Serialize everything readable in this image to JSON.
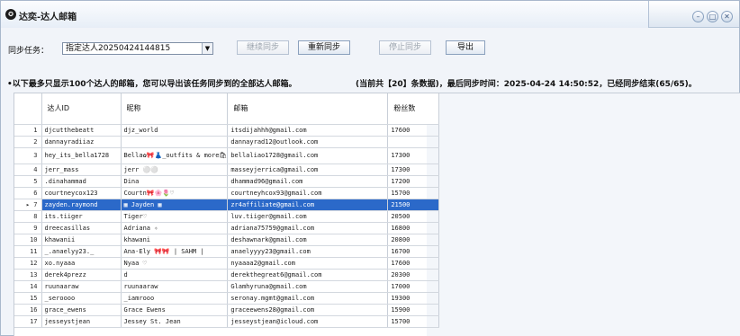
{
  "window": {
    "icon_glyph": "✪",
    "title": "达奕-达人邮箱",
    "controls": [
      "–",
      "□",
      "✕"
    ]
  },
  "toolbar": {
    "sync_task_label": "同步任务：",
    "sync_task_value": "指定达人20250424144815",
    "continue_sync": "继续同步",
    "resync": "重新同步",
    "stop_sync": "停止同步",
    "export": "导出"
  },
  "notice": "•以下最多只显示100个达人的邮箱，您可以导出该任务同步到的全部达人邮箱。",
  "status": "(当前共【20】条数据)，最后同步时间：2025-04-24 14:50:52，已经同步结束(65/65)。",
  "table": {
    "columns": [
      "达人ID",
      "昵称",
      "邮箱",
      "粉丝数"
    ],
    "selected_index": 6,
    "rows": [
      {
        "n": "1",
        "id": "djcutthebeatt",
        "nick": "djz_world",
        "email": "itsdijahhh@gmail.com",
        "fans": "17600"
      },
      {
        "n": "2",
        "id": "dannayradiiaz",
        "nick": "",
        "email": "dannayrad12@outlook.com",
        "fans": ""
      },
      {
        "n": "3",
        "id": "hey_its_bella1728",
        "nick": "Bella✿🎀👗_outfits & more🛍",
        "email": "bellaliao1728@gmail.com",
        "fans": "17300"
      },
      {
        "n": "4",
        "id": "jerr_mass",
        "nick": "jerr ⚪⚪",
        "email": "masseyjerrica@gmail.com",
        "fans": "17300"
      },
      {
        "n": "5",
        "id": ".dinahammad",
        "nick": "Dina",
        "email": "dhammad96@gmail.com",
        "fans": "17200"
      },
      {
        "n": "6",
        "id": "courtneycox123",
        "nick": "Courtn🎀🌸🌷♡",
        "email": "courtneyhcox93@gmail.com",
        "fans": "15700"
      },
      {
        "n": "7",
        "id": "zayden.raymond",
        "nick": "▦ Jayden ▦",
        "email": "zr4affiliate@gmail.com",
        "fans": "21500"
      },
      {
        "n": "8",
        "id": "its.tiiger",
        "nick": "Tiger♡",
        "email": "luv.tiiger@gmail.com",
        "fans": "20500"
      },
      {
        "n": "9",
        "id": "dreecasillas",
        "nick": "Adriana ✧",
        "email": "adriana75759@gmail.com",
        "fans": "16800"
      },
      {
        "n": "10",
        "id": "khawanii",
        "nick": "khawani",
        "email": "deshawnark@gmail.com",
        "fans": "20800"
      },
      {
        "n": "11",
        "id": "_.anaelyy23._",
        "nick": "Ana-Ely 🎀🎀 | SAHM |",
        "email": "anaelyyyy23@gmail.com",
        "fans": "16700"
      },
      {
        "n": "12",
        "id": "xo.nyaaa",
        "nick": "Nyaa ♡",
        "email": "nyaaaa2@gmail.com",
        "fans": "17600"
      },
      {
        "n": "13",
        "id": "derek4prezz",
        "nick": "d",
        "email": "derekthegreat6@gmail.com",
        "fans": "20300"
      },
      {
        "n": "14",
        "id": "ruunaaraw",
        "nick": "ruunaaraw",
        "email": "Glamhyruna@gmail.com",
        "fans": "17000"
      },
      {
        "n": "15",
        "id": "_seroooo",
        "nick": "_iamrooo",
        "email": "seronay.mgmt@gmail.com",
        "fans": "19300"
      },
      {
        "n": "16",
        "id": "grace_ewens",
        "nick": "Grace Ewens",
        "email": "graceewens28@gmail.com",
        "fans": "15900"
      },
      {
        "n": "17",
        "id": "jesseystjean",
        "nick": "Jessey St. Jean",
        "email": "jesseystjean@icloud.com",
        "fans": "15700"
      }
    ]
  },
  "colors": {
    "selection": "#2b69c9",
    "titlebar": "#dde6f1",
    "background": "#f1f4f9"
  },
  "icons": {
    "row_pointer": "triangle-right-icon",
    "dropdown": "chevron-down-icon"
  }
}
